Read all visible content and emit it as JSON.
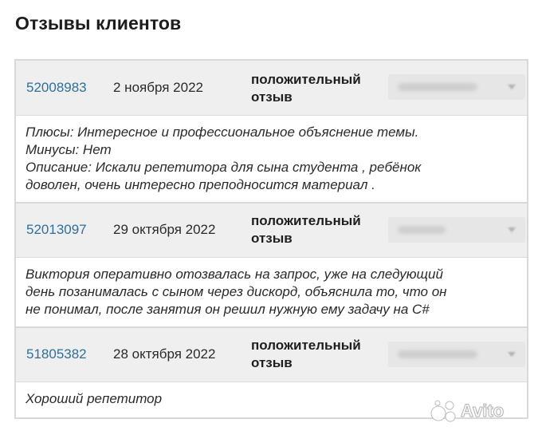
{
  "page": {
    "title": "Отзывы клиентов"
  },
  "reviews": [
    {
      "id": "52008983",
      "date": "2 ноября 2022",
      "type": "положительный отзыв",
      "text_lines": [
        "Плюсы: Интересное и профессиональное объяснение темы.",
        "Минусы: Нет",
        "Описание: Искали репетитора для сына студента , ребёнок",
        "доволен, очень интересно преподносится материал ."
      ]
    },
    {
      "id": "52013097",
      "date": "29 октября 2022",
      "type": "положительный отзыв",
      "text_lines": [
        "Виктория оперативно отозвалась на запрос, уже на следующий",
        "день позанималась с сыном через дискорд, объяснила то, что он",
        "не понимал, после занятия он решил нужную ему задачу на C#"
      ]
    },
    {
      "id": "51805382",
      "date": "28 октября 2022",
      "type": "положительный отзыв",
      "text_lines": [
        "Хороший репетитор"
      ]
    }
  ],
  "watermark": {
    "text": "Avito",
    "icon": "avito-dots-icon"
  },
  "colors": {
    "link": "#2f6f9d",
    "header_bg": "#efefef",
    "border": "#d9d9d9"
  }
}
